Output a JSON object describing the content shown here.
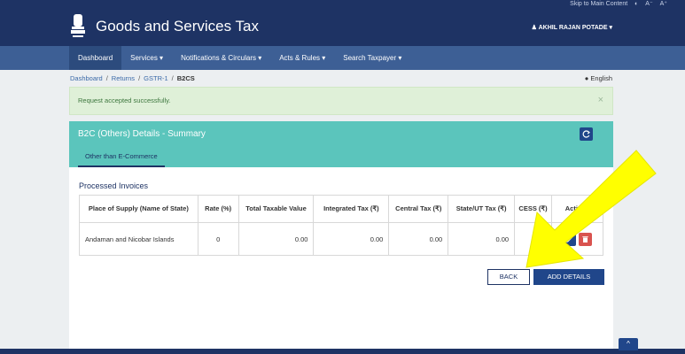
{
  "header": {
    "skip_link": "Skip to Main Content",
    "title": "Goods and Services Tax",
    "user_name": "AKHIL RAJAN POTADE",
    "emblem_icon": "national-emblem-icon"
  },
  "nav": {
    "items": [
      {
        "label": "Dashboard"
      },
      {
        "label": "Services ▾"
      },
      {
        "label": "Notifications & Circulars ▾"
      },
      {
        "label": "Acts & Rules ▾"
      },
      {
        "label": "Search Taxpayer ▾"
      }
    ]
  },
  "breadcrumb": {
    "items": [
      "Dashboard",
      "Returns",
      "GSTR-1",
      "B2CS"
    ]
  },
  "language": "English",
  "alert": {
    "message": "Request accepted successfully.",
    "close": "×"
  },
  "panel": {
    "title": "B2C (Others) Details - Summary",
    "tab": "Other than E-Commerce",
    "section_title": "Processed Invoices"
  },
  "table": {
    "headers": {
      "place": "Place of Supply (Name of State)",
      "rate": "Rate (%)",
      "taxable": "Total Taxable Value",
      "igst": "Integrated Tax (₹)",
      "cgst": "Central Tax (₹)",
      "sgst": "State/UT Tax (₹)",
      "cess": "CESS (₹)",
      "actions": "Actions"
    },
    "row": {
      "place": "Andaman and Nicobar Islands",
      "rate": "0",
      "taxable": "0.00",
      "igst": "0.00",
      "cgst": "0.00",
      "sgst": "0.00",
      "cess": "0.00"
    }
  },
  "buttons": {
    "back": "BACK",
    "add": "ADD DETAILS"
  },
  "scroll_top": "^",
  "colors": {
    "header": "#1e3364",
    "nav": "#3d5f95",
    "panel_head": "#5bc5bc",
    "primary": "#20468a",
    "annotation_arrow": "#ffff00"
  }
}
